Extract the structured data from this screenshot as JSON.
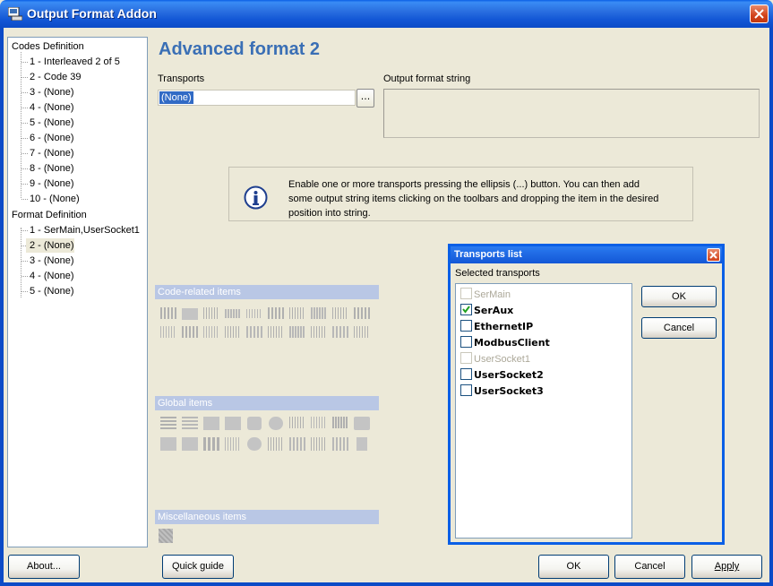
{
  "window": {
    "title": "Output Format Addon"
  },
  "tree": {
    "codes_header": "Codes Definition",
    "codes": [
      "1 - Interleaved 2 of 5",
      "2 - Code 39",
      "3 - (None)",
      "4 - (None)",
      "5 - (None)",
      "6 - (None)",
      "7 - (None)",
      "8 - (None)",
      "9 - (None)",
      "10 - (None)"
    ],
    "format_header": "Format Definition",
    "formats": [
      "1 - SerMain,UserSocket1",
      "2 - (None)",
      "3 - (None)",
      "4 - (None)",
      "5 - (None)"
    ],
    "selected_format": "2 - (None)"
  },
  "main": {
    "title": "Advanced format 2",
    "transports_label": "Transports",
    "transports_value": "(None)",
    "ellipsis_label": "...",
    "output_format_label": "Output format string",
    "info_text": "Enable one or more transports pressing the ellipsis (...) button. You can then add some output string items clicking on the toolbars and dropping the item in the desired position into string."
  },
  "groups": {
    "code_related": "Code-related items",
    "global": "Global items",
    "misc": "Miscellaneous items"
  },
  "buttons": {
    "about": "About...",
    "quick_guide": "Quick guide",
    "ok": "OK",
    "cancel": "Cancel",
    "apply": "Apply"
  },
  "dialog": {
    "title": "Transports list",
    "selected_label": "Selected transports",
    "items": [
      {
        "label": "SerMain",
        "checked": false,
        "enabled": false
      },
      {
        "label": "SerAux",
        "checked": true,
        "enabled": true
      },
      {
        "label": "EthernetIP",
        "checked": false,
        "enabled": true
      },
      {
        "label": "ModbusClient",
        "checked": false,
        "enabled": true
      },
      {
        "label": "UserSocket1",
        "checked": false,
        "enabled": false
      },
      {
        "label": "UserSocket2",
        "checked": false,
        "enabled": true
      },
      {
        "label": "UserSocket3",
        "checked": false,
        "enabled": true
      }
    ],
    "ok": "OK",
    "cancel": "Cancel"
  },
  "colors": {
    "titlebar": "#1357d6",
    "accent_title": "#3a6fb5",
    "group_header": "#b9c7e5",
    "selection": "#316ac5"
  }
}
